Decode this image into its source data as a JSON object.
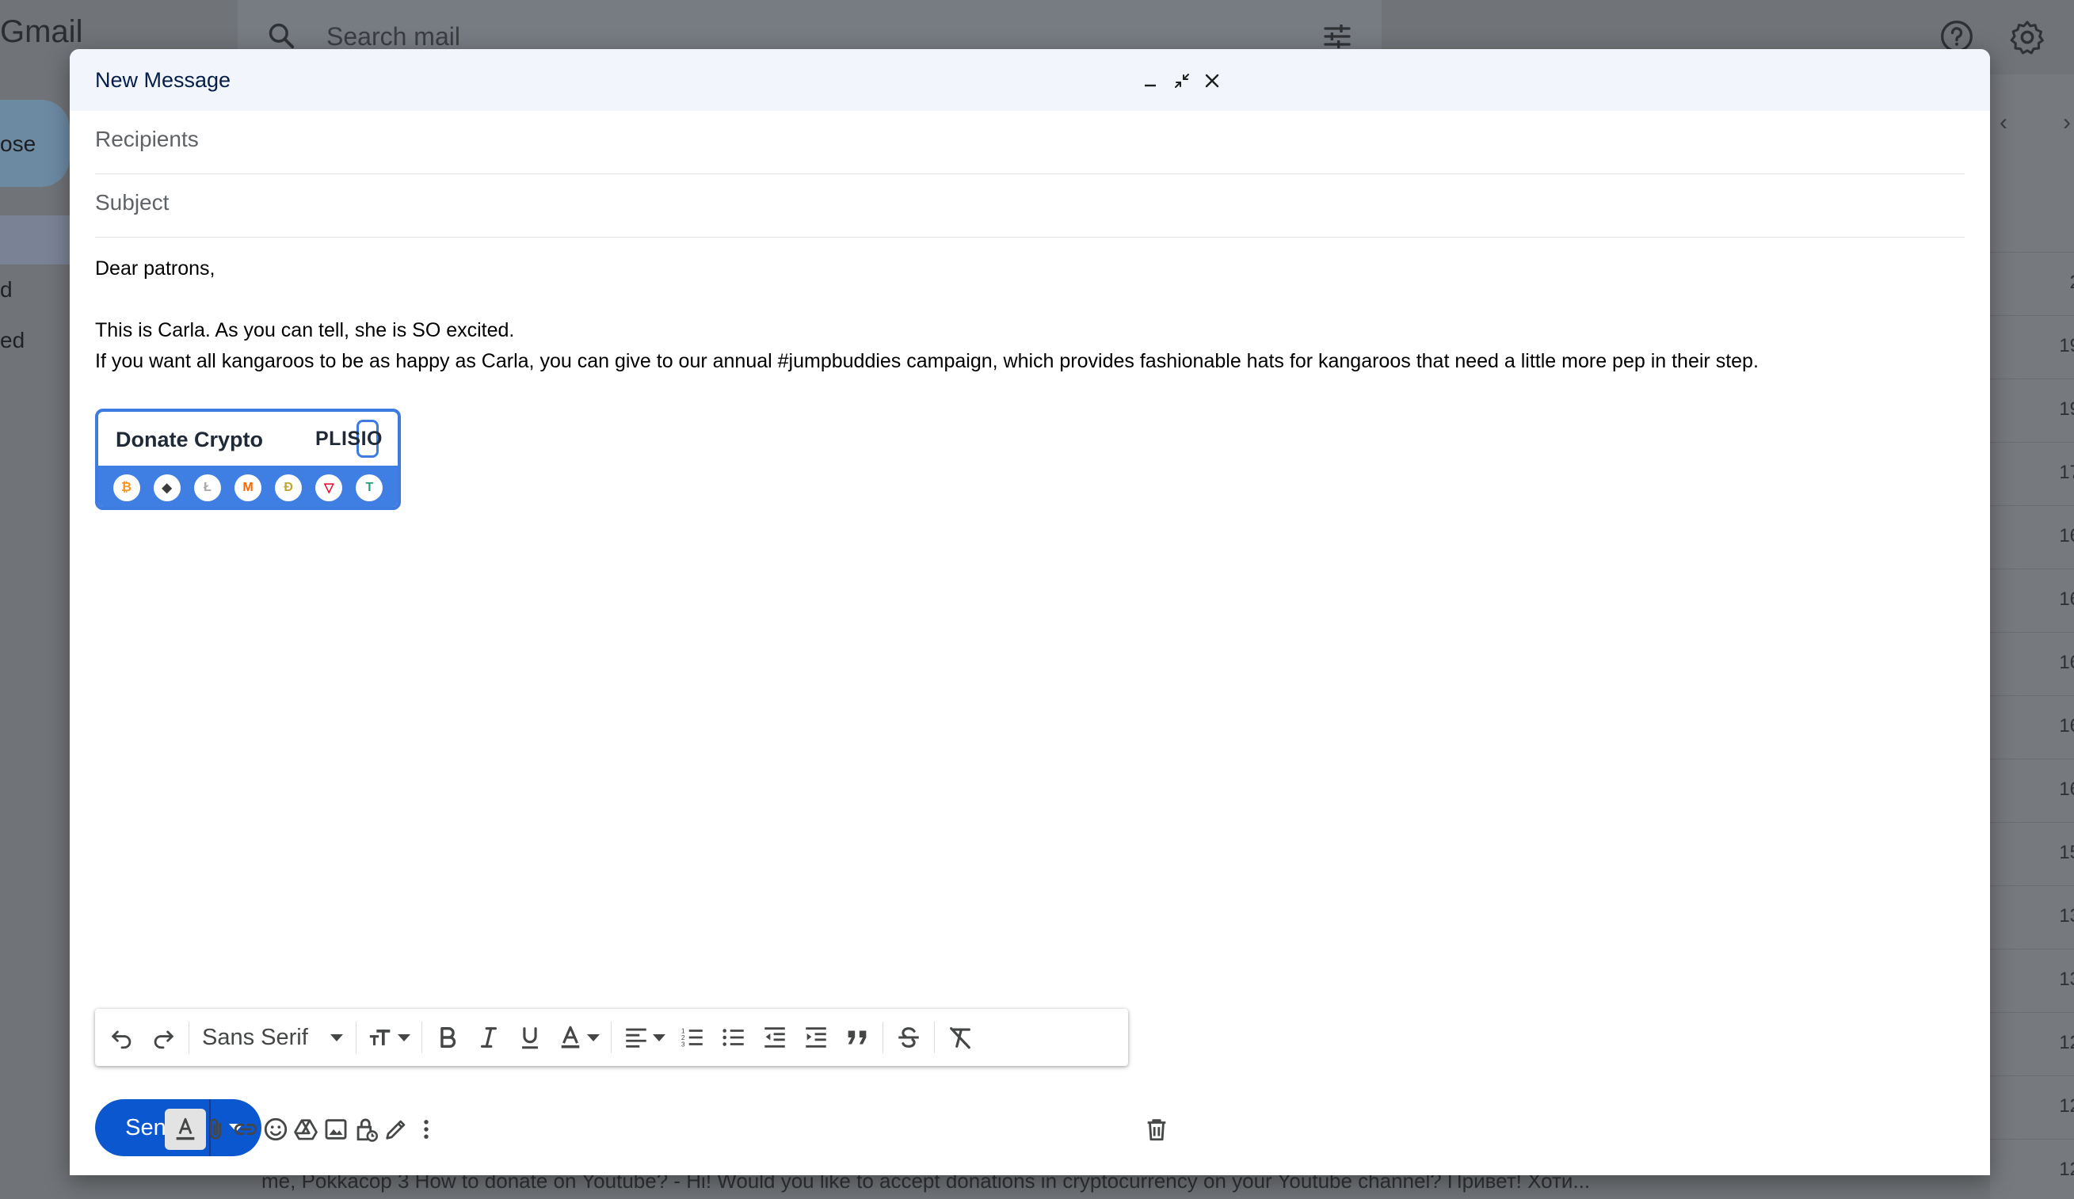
{
  "background": {
    "app_name": "Gmail",
    "search_placeholder": "Search mail",
    "compose_label": "ose",
    "nav_labels": [
      "d",
      "ed"
    ],
    "row_dates": [
      "2",
      "19",
      "19",
      "17",
      "16",
      "16",
      "16",
      "16",
      "16",
      "15",
      "13",
      "13",
      "12",
      "12",
      "12"
    ],
    "bottom_row_text": "me, Pokkacop 3            How to donate on Youtube? - Hi! Would you like to accept donations in cryptocurrency on your Youtube channel? Привет! Хоти..."
  },
  "compose": {
    "title": "New Message",
    "recipients_placeholder": "Recipients",
    "subject_placeholder": "Subject",
    "body": {
      "greeting": "Dear patrons,",
      "line1": "This is Carla. As you can tell, she is SO excited.",
      "line2": "If you want all kangaroos to be as happy as Carla, you can give to our annual #jumpbuddies campaign, which provides fashionable hats for kangaroos that need a little more pep in their step."
    },
    "donate_widget": {
      "label": "Donate Crypto",
      "brand": "PLISIO",
      "coins": [
        {
          "name": "bitcoin-icon",
          "glyph": "₿",
          "color": "#f7931a"
        },
        {
          "name": "ethereum-icon",
          "glyph": "◆",
          "color": "#3c3c3d"
        },
        {
          "name": "litecoin-icon",
          "glyph": "Ł",
          "color": "#a6a9aa"
        },
        {
          "name": "monero-icon",
          "glyph": "M",
          "color": "#ff6600"
        },
        {
          "name": "dogecoin-icon",
          "glyph": "Ð",
          "color": "#c2a633"
        },
        {
          "name": "tron-icon",
          "glyph": "▽",
          "color": "#ef0027"
        },
        {
          "name": "tether-icon",
          "glyph": "T",
          "color": "#26a17b"
        }
      ]
    },
    "toolbar": {
      "font_family": "Sans Serif"
    },
    "send_label": "Send"
  }
}
